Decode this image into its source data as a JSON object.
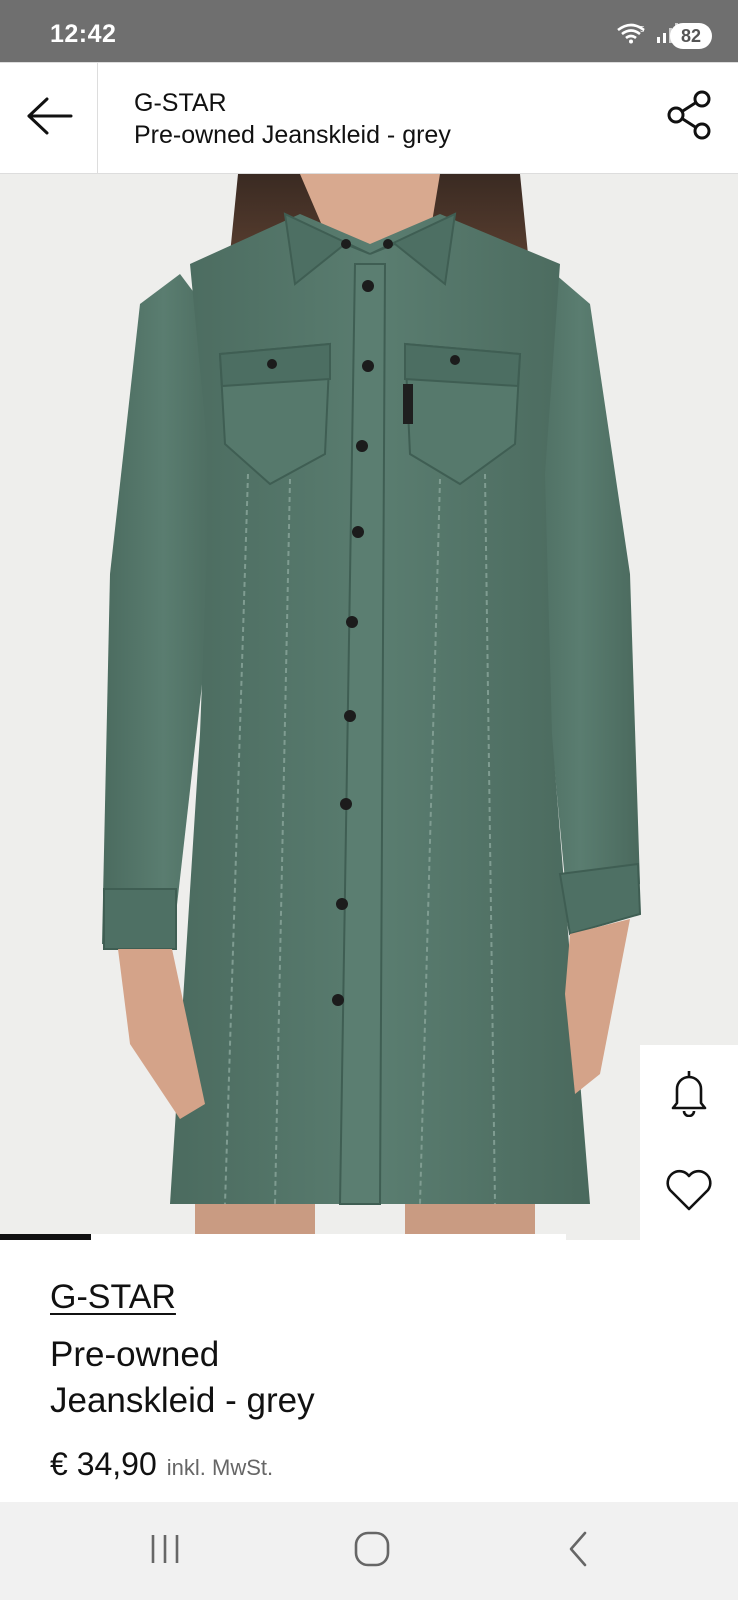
{
  "status_bar": {
    "time": "12:42",
    "battery": "82",
    "icons": [
      "wifi-icon",
      "signal-icon"
    ]
  },
  "header": {
    "brand": "G-STAR",
    "title": "Pre-owned Jeanskleid - grey",
    "back_icon": "arrow-left-icon",
    "share_icon": "share-icon"
  },
  "gallery": {
    "progress_fraction": 0.16,
    "actions": [
      "bell-icon",
      "heart-icon"
    ]
  },
  "product": {
    "brand": "G-STAR",
    "title_line1": "Pre-owned",
    "title_line2": "Jeanskleid - grey",
    "price": "€ 34,90",
    "tax_note": "inkl. MwSt."
  },
  "nav_bar": {
    "buttons": [
      "recent-apps-icon",
      "home-icon",
      "back-icon"
    ]
  },
  "colors": {
    "status_bar": "#6f6f6f",
    "dress": "#54766a",
    "image_background": "#eeeeec",
    "nav_bar": "#f1f1f1",
    "text": "#111111"
  }
}
